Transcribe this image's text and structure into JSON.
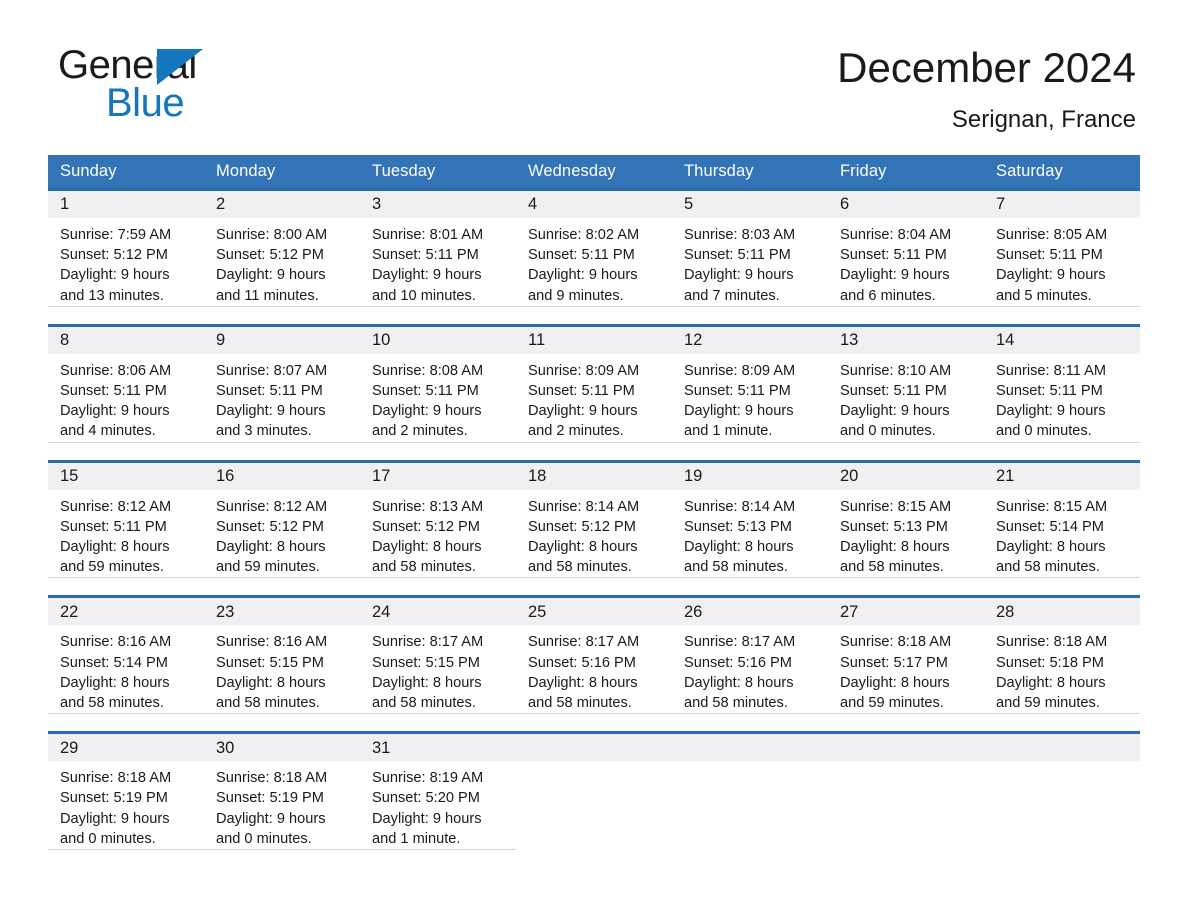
{
  "brand": {
    "word1": "General",
    "word2": "Blue",
    "triangle_color": "#1476bd",
    "icon": "triangle-logo-icon"
  },
  "header": {
    "month_title": "December 2024",
    "location": "Serignan, France"
  },
  "theme": {
    "header_blue": "#3274b5",
    "rule_blue": "#2b6cad",
    "daynum_band": "#f0f0f0",
    "cell_border": "#d7d7d7",
    "text": "#1a1a1a"
  },
  "calendar": {
    "weekdays": [
      "Sunday",
      "Monday",
      "Tuesday",
      "Wednesday",
      "Thursday",
      "Friday",
      "Saturday"
    ],
    "weeks": [
      [
        {
          "day": "1",
          "sunrise": "Sunrise: 7:59 AM",
          "sunset": "Sunset: 5:12 PM",
          "daylight1": "Daylight: 9 hours",
          "daylight2": "and 13 minutes."
        },
        {
          "day": "2",
          "sunrise": "Sunrise: 8:00 AM",
          "sunset": "Sunset: 5:12 PM",
          "daylight1": "Daylight: 9 hours",
          "daylight2": "and 11 minutes."
        },
        {
          "day": "3",
          "sunrise": "Sunrise: 8:01 AM",
          "sunset": "Sunset: 5:11 PM",
          "daylight1": "Daylight: 9 hours",
          "daylight2": "and 10 minutes."
        },
        {
          "day": "4",
          "sunrise": "Sunrise: 8:02 AM",
          "sunset": "Sunset: 5:11 PM",
          "daylight1": "Daylight: 9 hours",
          "daylight2": "and 9 minutes."
        },
        {
          "day": "5",
          "sunrise": "Sunrise: 8:03 AM",
          "sunset": "Sunset: 5:11 PM",
          "daylight1": "Daylight: 9 hours",
          "daylight2": "and 7 minutes."
        },
        {
          "day": "6",
          "sunrise": "Sunrise: 8:04 AM",
          "sunset": "Sunset: 5:11 PM",
          "daylight1": "Daylight: 9 hours",
          "daylight2": "and 6 minutes."
        },
        {
          "day": "7",
          "sunrise": "Sunrise: 8:05 AM",
          "sunset": "Sunset: 5:11 PM",
          "daylight1": "Daylight: 9 hours",
          "daylight2": "and 5 minutes."
        }
      ],
      [
        {
          "day": "8",
          "sunrise": "Sunrise: 8:06 AM",
          "sunset": "Sunset: 5:11 PM",
          "daylight1": "Daylight: 9 hours",
          "daylight2": "and 4 minutes."
        },
        {
          "day": "9",
          "sunrise": "Sunrise: 8:07 AM",
          "sunset": "Sunset: 5:11 PM",
          "daylight1": "Daylight: 9 hours",
          "daylight2": "and 3 minutes."
        },
        {
          "day": "10",
          "sunrise": "Sunrise: 8:08 AM",
          "sunset": "Sunset: 5:11 PM",
          "daylight1": "Daylight: 9 hours",
          "daylight2": "and 2 minutes."
        },
        {
          "day": "11",
          "sunrise": "Sunrise: 8:09 AM",
          "sunset": "Sunset: 5:11 PM",
          "daylight1": "Daylight: 9 hours",
          "daylight2": "and 2 minutes."
        },
        {
          "day": "12",
          "sunrise": "Sunrise: 8:09 AM",
          "sunset": "Sunset: 5:11 PM",
          "daylight1": "Daylight: 9 hours",
          "daylight2": "and 1 minute."
        },
        {
          "day": "13",
          "sunrise": "Sunrise: 8:10 AM",
          "sunset": "Sunset: 5:11 PM",
          "daylight1": "Daylight: 9 hours",
          "daylight2": "and 0 minutes."
        },
        {
          "day": "14",
          "sunrise": "Sunrise: 8:11 AM",
          "sunset": "Sunset: 5:11 PM",
          "daylight1": "Daylight: 9 hours",
          "daylight2": "and 0 minutes."
        }
      ],
      [
        {
          "day": "15",
          "sunrise": "Sunrise: 8:12 AM",
          "sunset": "Sunset: 5:11 PM",
          "daylight1": "Daylight: 8 hours",
          "daylight2": "and 59 minutes."
        },
        {
          "day": "16",
          "sunrise": "Sunrise: 8:12 AM",
          "sunset": "Sunset: 5:12 PM",
          "daylight1": "Daylight: 8 hours",
          "daylight2": "and 59 minutes."
        },
        {
          "day": "17",
          "sunrise": "Sunrise: 8:13 AM",
          "sunset": "Sunset: 5:12 PM",
          "daylight1": "Daylight: 8 hours",
          "daylight2": "and 58 minutes."
        },
        {
          "day": "18",
          "sunrise": "Sunrise: 8:14 AM",
          "sunset": "Sunset: 5:12 PM",
          "daylight1": "Daylight: 8 hours",
          "daylight2": "and 58 minutes."
        },
        {
          "day": "19",
          "sunrise": "Sunrise: 8:14 AM",
          "sunset": "Sunset: 5:13 PM",
          "daylight1": "Daylight: 8 hours",
          "daylight2": "and 58 minutes."
        },
        {
          "day": "20",
          "sunrise": "Sunrise: 8:15 AM",
          "sunset": "Sunset: 5:13 PM",
          "daylight1": "Daylight: 8 hours",
          "daylight2": "and 58 minutes."
        },
        {
          "day": "21",
          "sunrise": "Sunrise: 8:15 AM",
          "sunset": "Sunset: 5:14 PM",
          "daylight1": "Daylight: 8 hours",
          "daylight2": "and 58 minutes."
        }
      ],
      [
        {
          "day": "22",
          "sunrise": "Sunrise: 8:16 AM",
          "sunset": "Sunset: 5:14 PM",
          "daylight1": "Daylight: 8 hours",
          "daylight2": "and 58 minutes."
        },
        {
          "day": "23",
          "sunrise": "Sunrise: 8:16 AM",
          "sunset": "Sunset: 5:15 PM",
          "daylight1": "Daylight: 8 hours",
          "daylight2": "and 58 minutes."
        },
        {
          "day": "24",
          "sunrise": "Sunrise: 8:17 AM",
          "sunset": "Sunset: 5:15 PM",
          "daylight1": "Daylight: 8 hours",
          "daylight2": "and 58 minutes."
        },
        {
          "day": "25",
          "sunrise": "Sunrise: 8:17 AM",
          "sunset": "Sunset: 5:16 PM",
          "daylight1": "Daylight: 8 hours",
          "daylight2": "and 58 minutes."
        },
        {
          "day": "26",
          "sunrise": "Sunrise: 8:17 AM",
          "sunset": "Sunset: 5:16 PM",
          "daylight1": "Daylight: 8 hours",
          "daylight2": "and 58 minutes."
        },
        {
          "day": "27",
          "sunrise": "Sunrise: 8:18 AM",
          "sunset": "Sunset: 5:17 PM",
          "daylight1": "Daylight: 8 hours",
          "daylight2": "and 59 minutes."
        },
        {
          "day": "28",
          "sunrise": "Sunrise: 8:18 AM",
          "sunset": "Sunset: 5:18 PM",
          "daylight1": "Daylight: 8 hours",
          "daylight2": "and 59 minutes."
        }
      ],
      [
        {
          "day": "29",
          "sunrise": "Sunrise: 8:18 AM",
          "sunset": "Sunset: 5:19 PM",
          "daylight1": "Daylight: 9 hours",
          "daylight2": "and 0 minutes."
        },
        {
          "day": "30",
          "sunrise": "Sunrise: 8:18 AM",
          "sunset": "Sunset: 5:19 PM",
          "daylight1": "Daylight: 9 hours",
          "daylight2": "and 0 minutes."
        },
        {
          "day": "31",
          "sunrise": "Sunrise: 8:19 AM",
          "sunset": "Sunset: 5:20 PM",
          "daylight1": "Daylight: 9 hours",
          "daylight2": "and 1 minute."
        },
        {
          "day": "",
          "sunrise": "",
          "sunset": "",
          "daylight1": "",
          "daylight2": ""
        },
        {
          "day": "",
          "sunrise": "",
          "sunset": "",
          "daylight1": "",
          "daylight2": ""
        },
        {
          "day": "",
          "sunrise": "",
          "sunset": "",
          "daylight1": "",
          "daylight2": ""
        },
        {
          "day": "",
          "sunrise": "",
          "sunset": "",
          "daylight1": "",
          "daylight2": ""
        }
      ]
    ]
  }
}
